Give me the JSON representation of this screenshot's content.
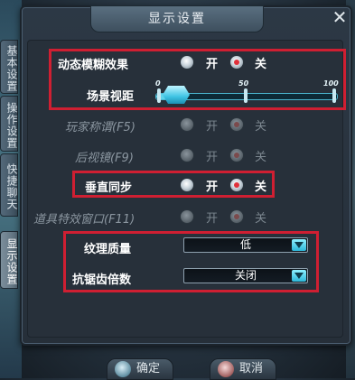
{
  "window": {
    "title": "显示设置",
    "close_glyph": "✕"
  },
  "side_tabs": [
    "基本设置",
    "操作设置",
    "快捷聊天",
    "显示设置"
  ],
  "rows": {
    "motion_blur": {
      "label": "动态模糊效果",
      "on": "开",
      "off": "关",
      "selected": "off"
    },
    "view_distance": {
      "label": "场景视距",
      "ticks": [
        "0",
        "50",
        "100"
      ],
      "value": 8
    },
    "player_title": {
      "label": "玩家称谓(F5)",
      "on": "开",
      "off": "关",
      "selected": "off"
    },
    "rear_mirror": {
      "label": "后视镜(F9)",
      "on": "开",
      "off": "关",
      "selected": "off"
    },
    "vsync": {
      "label": "垂直同步",
      "on": "开",
      "off": "关",
      "selected": "off"
    },
    "item_effects": {
      "label": "道具特效窗口(F11)",
      "on": "开",
      "off": "关",
      "selected": "off"
    },
    "texture_quality": {
      "label": "纹理质量",
      "value": "低"
    },
    "antialiasing": {
      "label": "抗锯齿倍数",
      "value": "关闭"
    }
  },
  "buttons": {
    "confirm": "确定",
    "cancel": "取消"
  },
  "colors": {
    "highlight": "#cf1f32",
    "accent": "#5fd3ea"
  }
}
